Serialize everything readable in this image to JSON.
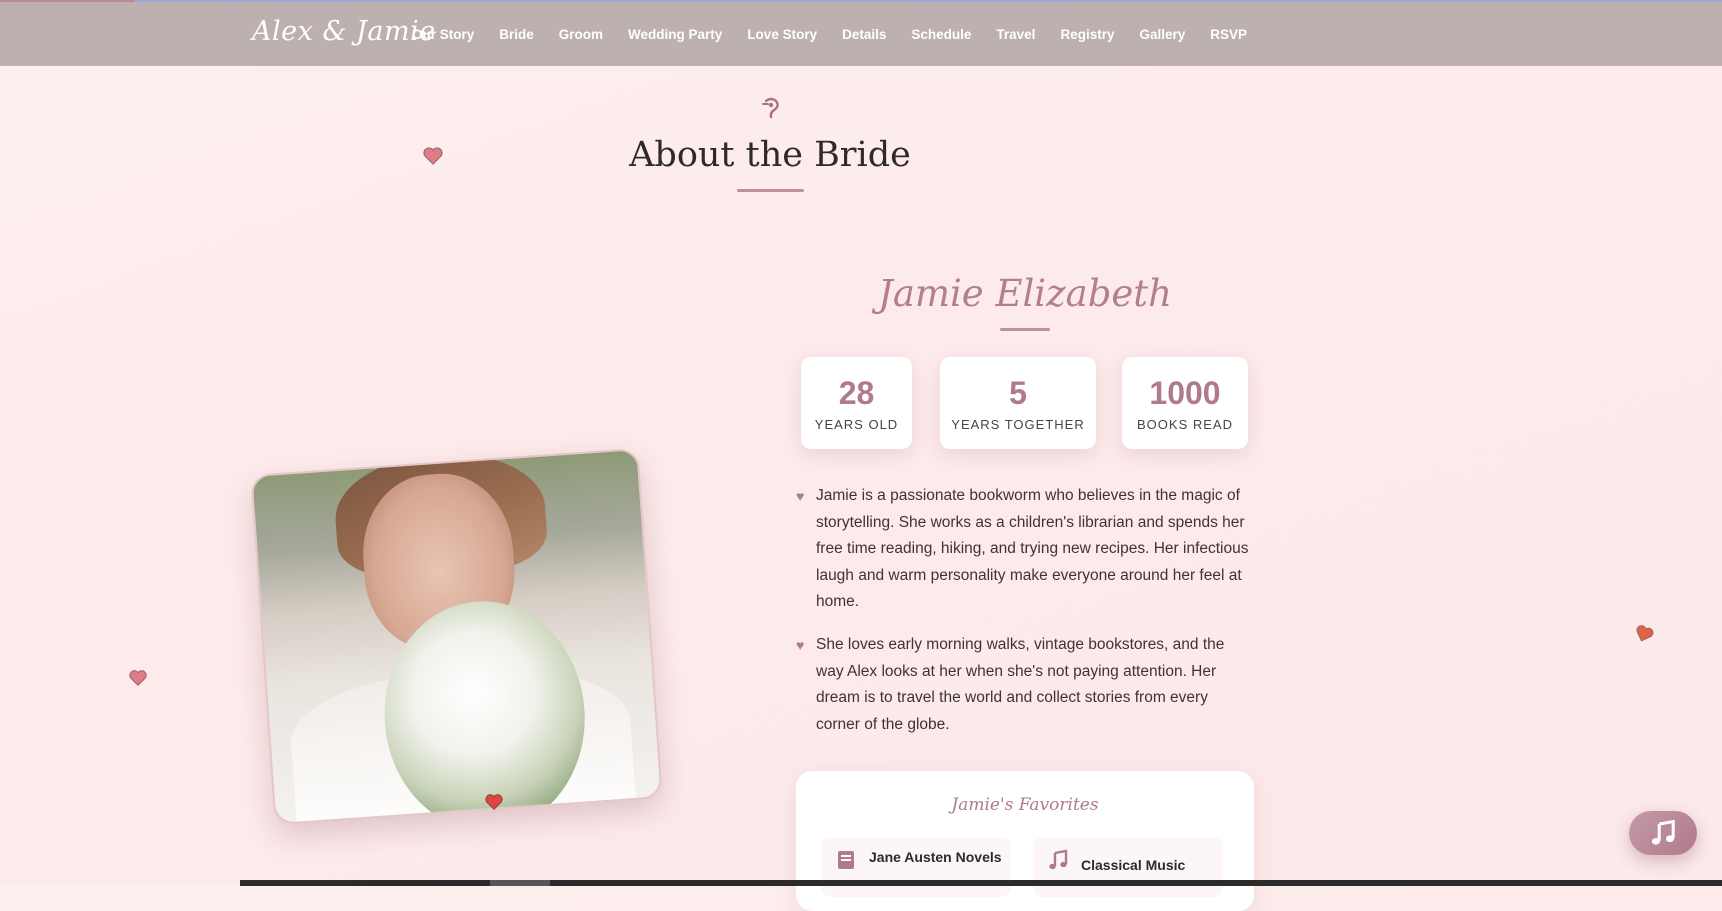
{
  "nav": {
    "brand": "Alex & Jamie",
    "links": [
      "Our Story",
      "Bride",
      "Groom",
      "Wedding Party",
      "Love Story",
      "Details",
      "Schedule",
      "Travel",
      "Registry",
      "Gallery",
      "RSVP"
    ]
  },
  "section": {
    "title": "About the Bride",
    "icon": "cupid-bow-icon"
  },
  "bride": {
    "name": "Jamie Elizabeth",
    "stats": [
      {
        "value": "28",
        "label": "YEARS OLD"
      },
      {
        "value": "5",
        "label": "YEARS TOGETHER"
      },
      {
        "value": "1000",
        "label": "BOOKS READ"
      }
    ],
    "bio": [
      "Jamie is a passionate bookworm who believes in the magic of storytelling. She works as a children's librarian and spends her free time reading, hiking, and trying new recipes. Her infectious laugh and warm personality make everyone around her feel at home.",
      "She loves early morning walks, vintage bookstores, and the way Alex looks at her when she's not paying attention. Her dream is to travel the world and collect stories from every corner of the globe."
    ],
    "bio_bullet": "♥"
  },
  "favorites": {
    "title": "Jamie's Favorites",
    "items": [
      {
        "label": "Jane Austen Novels",
        "icon": "book-icon"
      },
      {
        "label": "Classical Music",
        "icon": "music-note-icon"
      }
    ]
  },
  "colors": {
    "accent": "#b07a8a",
    "nav_bg": "#bdb0b1",
    "page_bg": "#fdeaea"
  }
}
